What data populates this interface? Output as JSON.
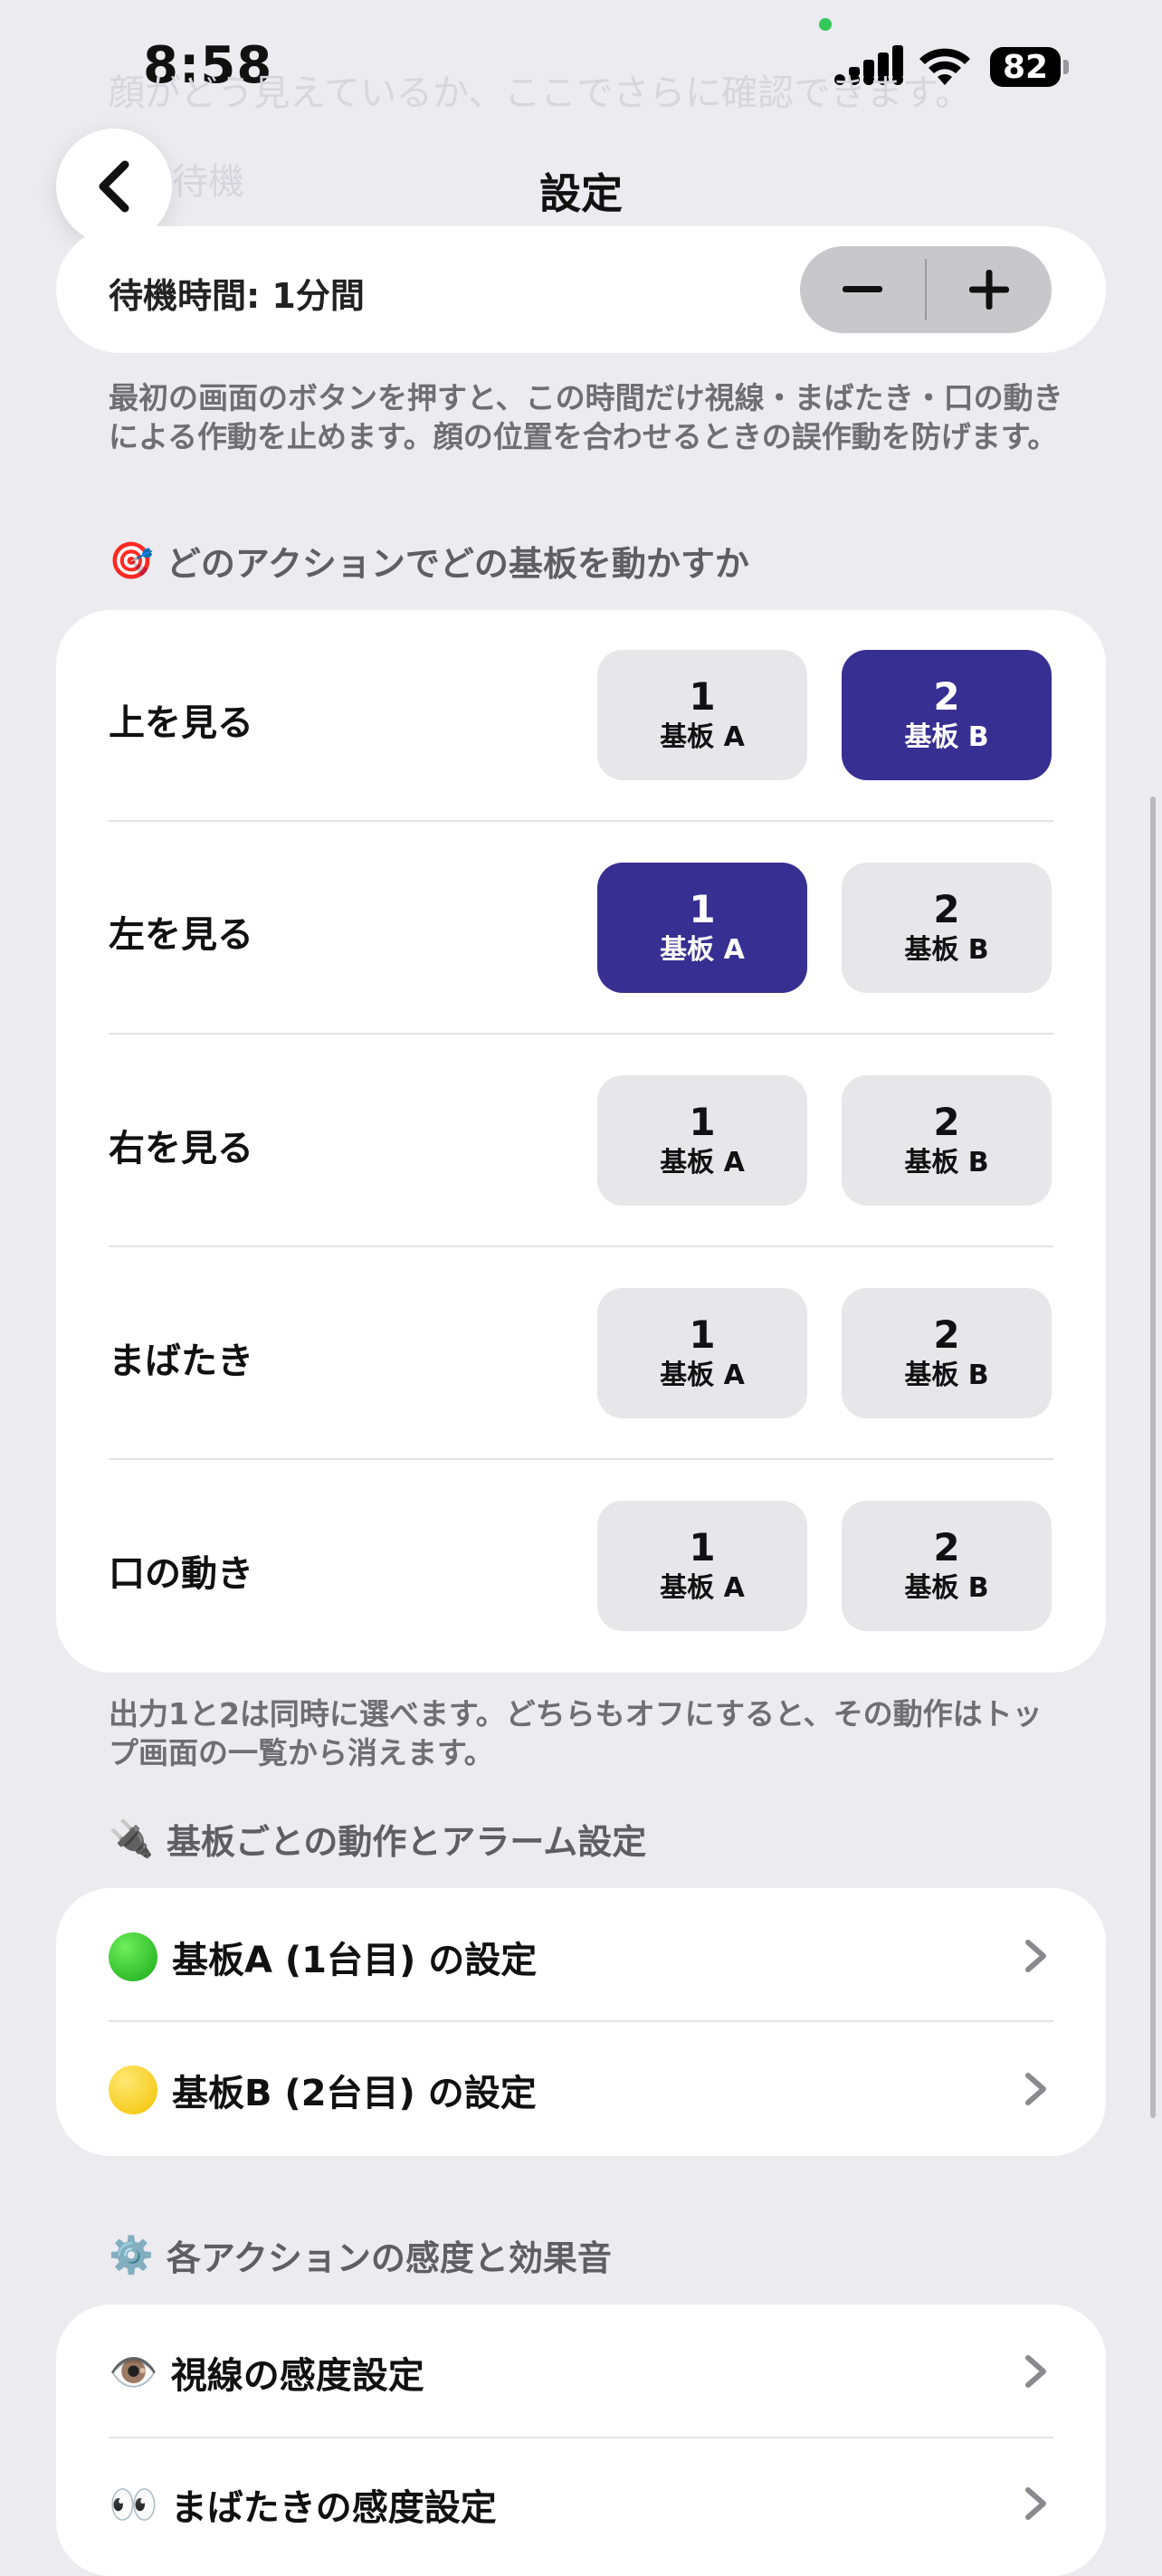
{
  "status": {
    "time": "8:58",
    "battery": "82"
  },
  "ghost_text": {
    "line1": "顔がどう見えているか、ここでさらに確認できます。",
    "line2": "待機"
  },
  "nav": {
    "title": "設定"
  },
  "wait": {
    "label": "待機時間: 1分間",
    "minus": "−",
    "plus": "+"
  },
  "wait_desc": "最初の画面のボタンを押すと、この時間だけ視線・まばたき・口の動きによる作動を止めます。顔の位置を合わせるときの誤作動を防げます。",
  "mapping_section": {
    "emoji": "🎯",
    "title": "どのアクションでどの基板を動かすか"
  },
  "mapping": {
    "option1": {
      "num": "1",
      "sub": "基板 A"
    },
    "option2": {
      "num": "2",
      "sub": "基板 B"
    },
    "rows": [
      {
        "label": "上を見る",
        "board1_on": false,
        "board2_on": true
      },
      {
        "label": "左を見る",
        "board1_on": true,
        "board2_on": false
      },
      {
        "label": "右を見る",
        "board1_on": false,
        "board2_on": false
      },
      {
        "label": "まばたき",
        "board1_on": false,
        "board2_on": false
      },
      {
        "label": "口の動き",
        "board1_on": false,
        "board2_on": false
      }
    ],
    "selected_color": "#372f91",
    "unselected_color": "#e7e7ea"
  },
  "mapping_desc": "出力1と2は同時に選べます。どちらもオフにすると、その動作はトップ画面の一覧から消えます。",
  "board_section": {
    "emoji": "🔌",
    "title": "基板ごとの動作とアラーム設定"
  },
  "board_items": [
    {
      "icon": "green-circle-icon",
      "label": "基板A (1台目) の設定"
    },
    {
      "icon": "yellow-circle-icon",
      "label": "基板B (2台目) の設定"
    }
  ],
  "sense_section": {
    "emoji": "⚙️",
    "title": "各アクションの感度と効果音"
  },
  "sense_items": [
    {
      "emoji": "👁️",
      "label": "視線の感度設定"
    },
    {
      "emoji": "👀",
      "label": "まばたきの感度設定"
    }
  ]
}
